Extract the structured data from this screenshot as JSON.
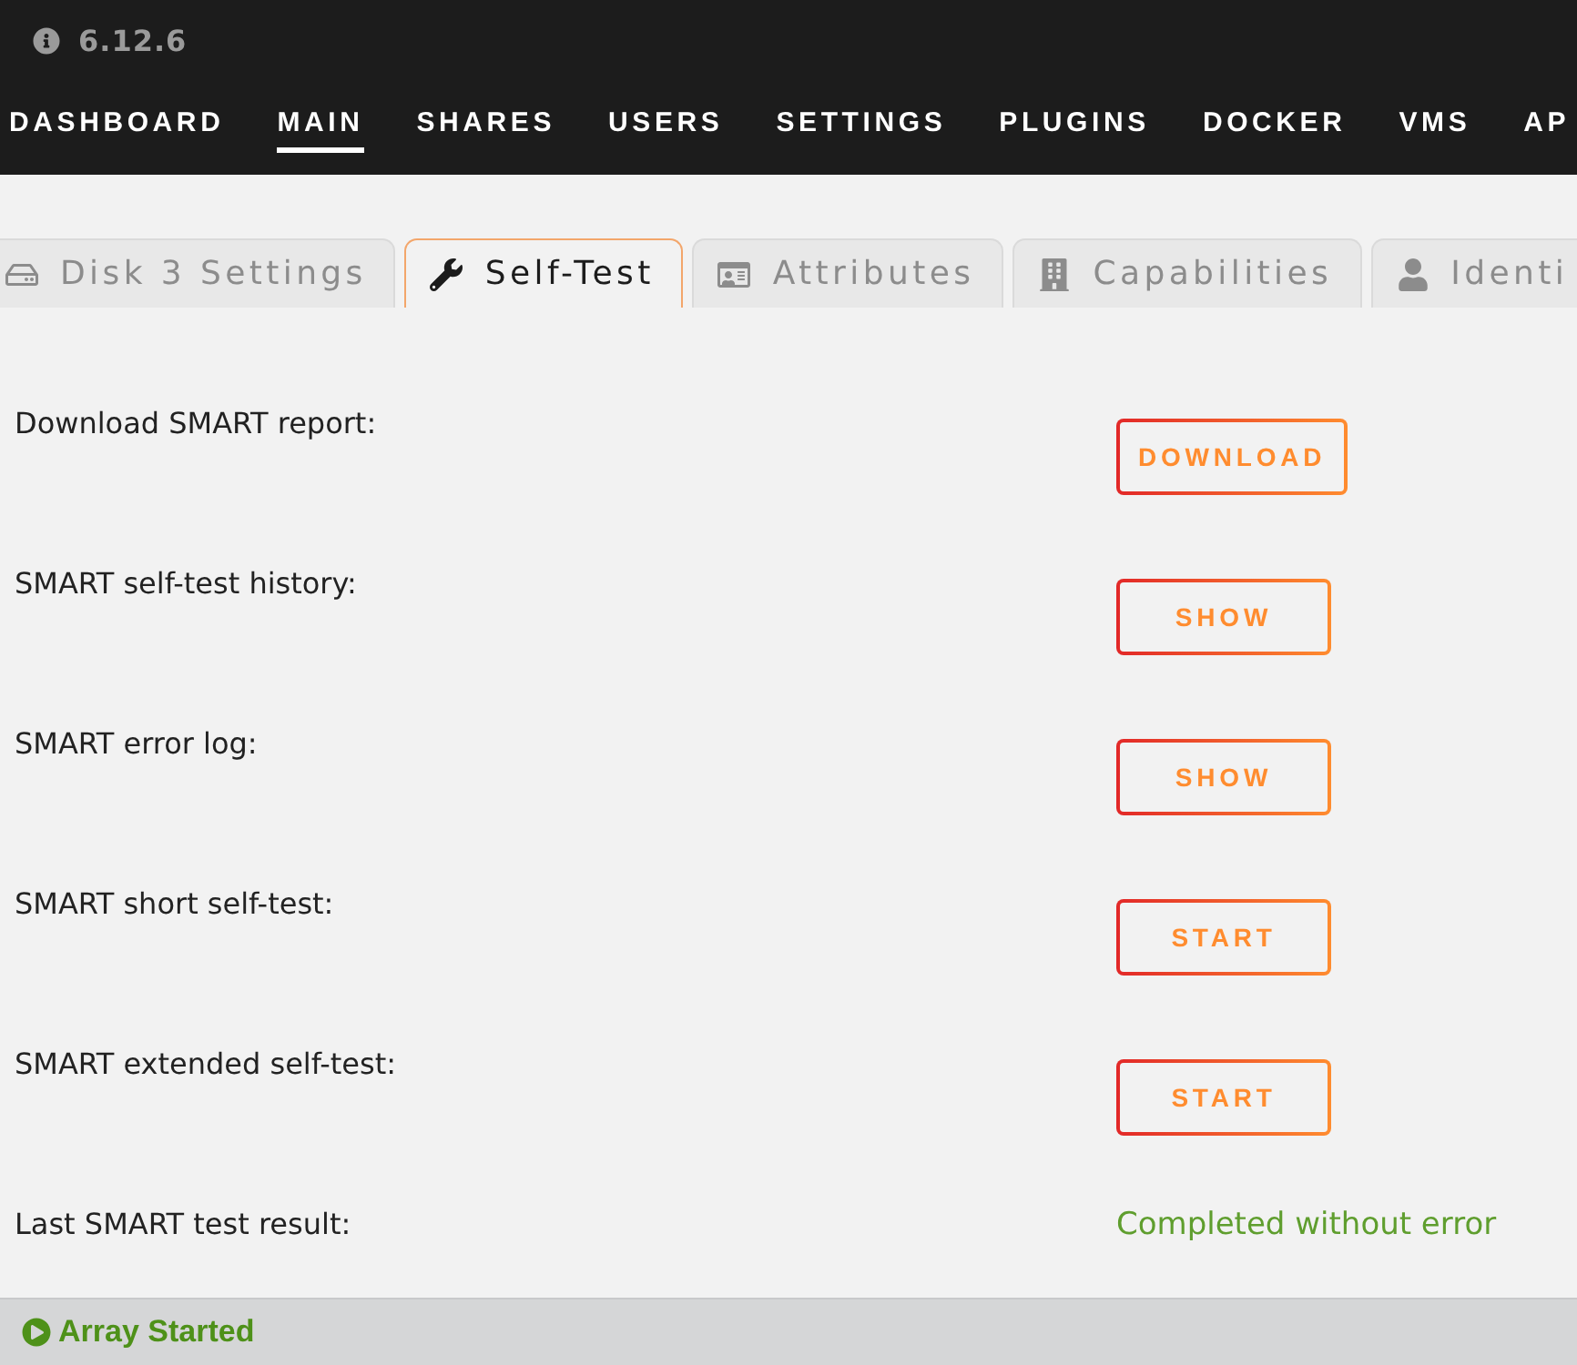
{
  "header": {
    "version": "6.12.6",
    "nav": [
      {
        "label": "DASHBOARD",
        "selected": false
      },
      {
        "label": "MAIN",
        "selected": true
      },
      {
        "label": "SHARES",
        "selected": false
      },
      {
        "label": "USERS",
        "selected": false
      },
      {
        "label": "SETTINGS",
        "selected": false
      },
      {
        "label": "PLUGINS",
        "selected": false
      },
      {
        "label": "DOCKER",
        "selected": false
      },
      {
        "label": "VMS",
        "selected": false
      },
      {
        "label": "AP",
        "selected": false
      }
    ]
  },
  "tabs": [
    {
      "label": "Disk 3 Settings",
      "selected": false
    },
    {
      "label": "Self-Test",
      "selected": true
    },
    {
      "label": "Attributes",
      "selected": false
    },
    {
      "label": "Capabilities",
      "selected": false
    },
    {
      "label": "Identi",
      "selected": false
    }
  ],
  "rows": [
    {
      "kind": "action",
      "label": "Download SMART report:",
      "button": "DOWNLOAD"
    },
    {
      "kind": "action",
      "label": "SMART self-test history:",
      "button": "SHOW"
    },
    {
      "kind": "action",
      "label": "SMART error log:",
      "button": "SHOW"
    },
    {
      "kind": "action",
      "label": "SMART short self-test:",
      "button": "START"
    },
    {
      "kind": "action",
      "label": "SMART extended self-test:",
      "button": "START"
    },
    {
      "kind": "result",
      "label": "Last SMART test result:",
      "value": "Completed without error"
    }
  ],
  "status_bar": {
    "text": "Array Started"
  }
}
